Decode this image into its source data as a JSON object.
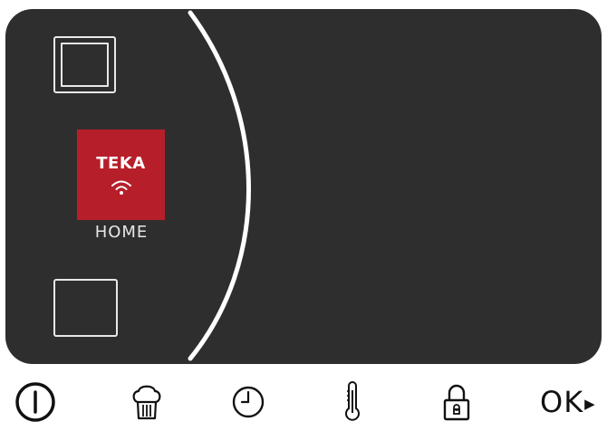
{
  "display": {
    "brand": {
      "logo_text": "TEKA",
      "color": "#b61f2a"
    },
    "home_label": "HOME",
    "screen_color": "#2f2e2f",
    "icons": [
      "oven-mode-icon",
      "blank-mode-icon",
      "wifi-icon"
    ]
  },
  "controls": {
    "icons": [
      "power-icon",
      "chef-hat-icon",
      "clock-icon",
      "thermometer-icon",
      "lock-icon"
    ],
    "ok_label": "OK",
    "ok_arrow": "▶"
  }
}
